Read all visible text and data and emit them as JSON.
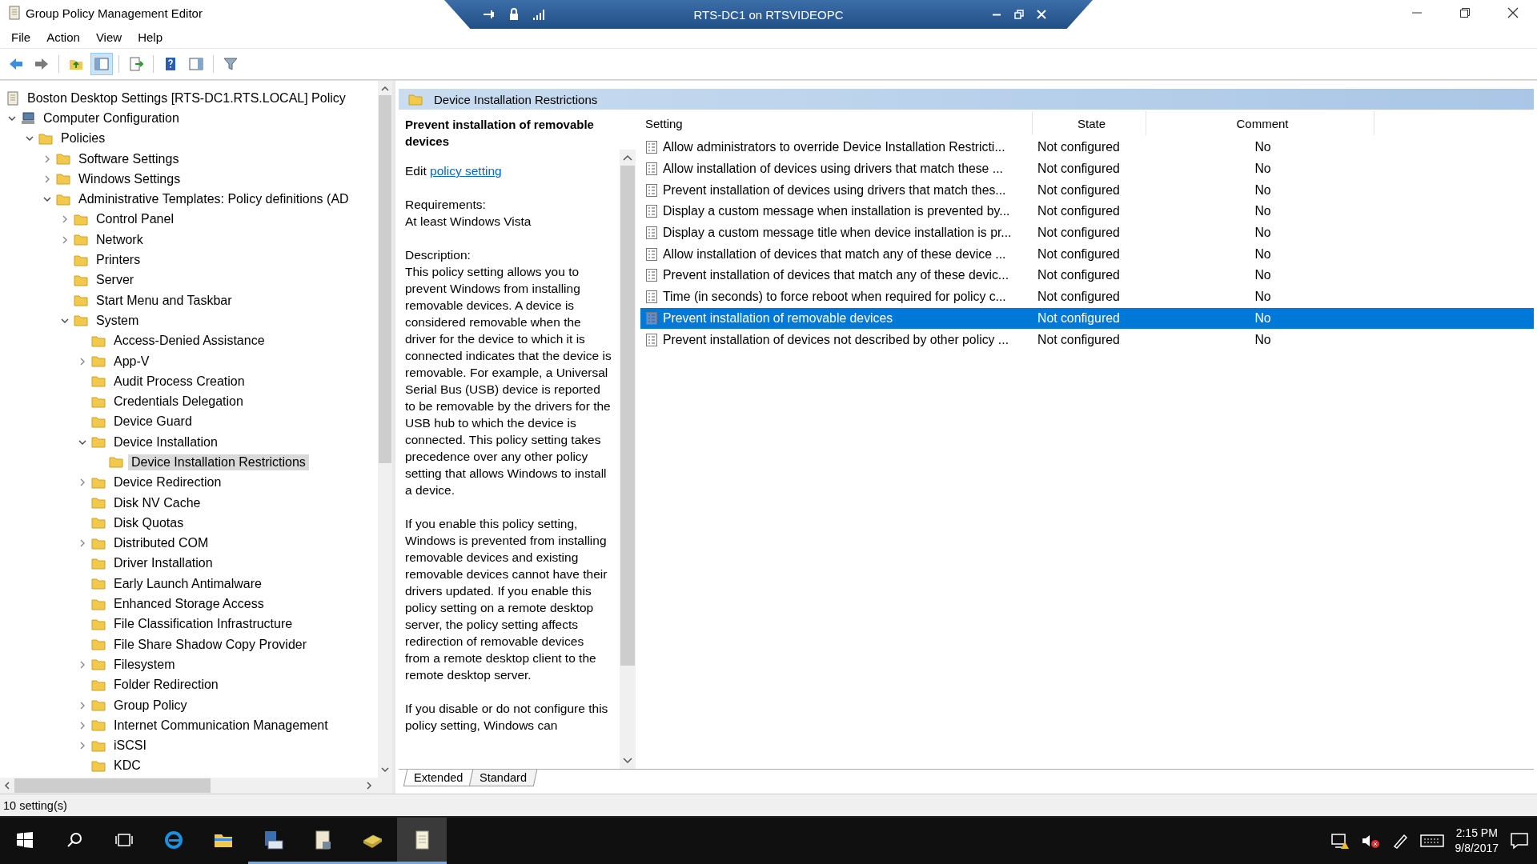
{
  "window": {
    "title": "Group Policy Management Editor"
  },
  "remote_bar": {
    "title": "RTS-DC1 on RTSVIDEOPC"
  },
  "menu": [
    "File",
    "Action",
    "View",
    "Help"
  ],
  "toolbar": [
    {
      "kind": "back"
    },
    {
      "kind": "forward"
    },
    {
      "kind": "sep"
    },
    {
      "kind": "up"
    },
    {
      "kind": "tree"
    },
    {
      "kind": "sep"
    },
    {
      "kind": "export"
    },
    {
      "kind": "sep"
    },
    {
      "kind": "help"
    },
    {
      "kind": "pane"
    },
    {
      "kind": "sep"
    },
    {
      "kind": "filter"
    }
  ],
  "tree": {
    "root": "Boston Desktop Settings [RTS-DC1.RTS.LOCAL] Policy",
    "items": [
      {
        "label": "Computer Configuration",
        "kind": "computer",
        "expanded": true,
        "children": [
          {
            "label": "Policies",
            "kind": "folder",
            "expanded": true,
            "children": [
              {
                "label": "Software Settings",
                "kind": "folder",
                "expanded": false
              },
              {
                "label": "Windows Settings",
                "kind": "folder",
                "expanded": false
              },
              {
                "label": "Administrative Templates: Policy definitions (AD",
                "kind": "folder",
                "expanded": true,
                "children": [
                  {
                    "label": "Control Panel",
                    "kind": "folder",
                    "expanded": false
                  },
                  {
                    "label": "Network",
                    "kind": "folder",
                    "expanded": false
                  },
                  {
                    "label": "Printers",
                    "kind": "folder"
                  },
                  {
                    "label": "Server",
                    "kind": "folder"
                  },
                  {
                    "label": "Start Menu and Taskbar",
                    "kind": "folder"
                  },
                  {
                    "label": "System",
                    "kind": "folder",
                    "expanded": true,
                    "children": [
                      {
                        "label": "Access-Denied Assistance",
                        "kind": "folder"
                      },
                      {
                        "label": "App-V",
                        "kind": "folder",
                        "expanded": false
                      },
                      {
                        "label": "Audit Process Creation",
                        "kind": "folder"
                      },
                      {
                        "label": "Credentials Delegation",
                        "kind": "folder"
                      },
                      {
                        "label": "Device Guard",
                        "kind": "folder"
                      },
                      {
                        "label": "Device Installation",
                        "kind": "folder",
                        "expanded": true,
                        "children": [
                          {
                            "label": "Device Installation Restrictions",
                            "kind": "folder",
                            "selected": true
                          }
                        ]
                      },
                      {
                        "label": "Device Redirection",
                        "kind": "folder",
                        "expanded": false
                      },
                      {
                        "label": "Disk NV Cache",
                        "kind": "folder"
                      },
                      {
                        "label": "Disk Quotas",
                        "kind": "folder"
                      },
                      {
                        "label": "Distributed COM",
                        "kind": "folder",
                        "expanded": false
                      },
                      {
                        "label": "Driver Installation",
                        "kind": "folder"
                      },
                      {
                        "label": "Early Launch Antimalware",
                        "kind": "folder"
                      },
                      {
                        "label": "Enhanced Storage Access",
                        "kind": "folder"
                      },
                      {
                        "label": "File Classification Infrastructure",
                        "kind": "folder"
                      },
                      {
                        "label": "File Share Shadow Copy Provider",
                        "kind": "folder"
                      },
                      {
                        "label": "Filesystem",
                        "kind": "folder",
                        "expanded": false
                      },
                      {
                        "label": "Folder Redirection",
                        "kind": "folder"
                      },
                      {
                        "label": "Group Policy",
                        "kind": "folder",
                        "expanded": false
                      },
                      {
                        "label": "Internet Communication Management",
                        "kind": "folder",
                        "expanded": false
                      },
                      {
                        "label": "iSCSI",
                        "kind": "folder",
                        "expanded": false
                      },
                      {
                        "label": "KDC",
                        "kind": "folder"
                      }
                    ]
                  }
                ]
              }
            ]
          }
        ]
      }
    ]
  },
  "pane_header": "Device Installation Restrictions",
  "description": {
    "title": "Prevent installation of removable devices",
    "edit_prefix": "Edit",
    "edit_link": "policy setting",
    "requirements_label": "Requirements:",
    "requirements": "At least Windows Vista",
    "description_label": "Description:",
    "paragraphs": [
      "This policy setting allows you to prevent Windows from installing removable devices. A device is considered removable when the driver for the device to which it is connected indicates that the device is removable. For example, a Universal Serial Bus (USB) device is reported to be removable by the drivers for the USB hub to which the device is connected. This policy setting takes precedence over any other policy setting that allows Windows to install a device.",
      "If you enable this policy setting, Windows is prevented from installing removable devices and existing removable devices cannot have their drivers updated. If you enable this policy setting on a remote desktop server, the policy setting affects redirection of removable devices from a remote desktop client to the remote desktop server.",
      "If you disable or do not configure this policy setting, Windows can"
    ]
  },
  "table": {
    "columns": [
      "Setting",
      "State",
      "Comment"
    ],
    "rows": [
      {
        "setting": "Allow administrators to override Device Installation Restricti...",
        "state": "Not configured",
        "comment": "No",
        "selected": false
      },
      {
        "setting": "Allow installation of devices using drivers that match these ...",
        "state": "Not configured",
        "comment": "No",
        "selected": false
      },
      {
        "setting": "Prevent installation of devices using drivers that match thes...",
        "state": "Not configured",
        "comment": "No",
        "selected": false
      },
      {
        "setting": "Display a custom message when installation is prevented by...",
        "state": "Not configured",
        "comment": "No",
        "selected": false
      },
      {
        "setting": "Display a custom message title when device installation is pr...",
        "state": "Not configured",
        "comment": "No",
        "selected": false
      },
      {
        "setting": "Allow installation of devices that match any of these device ...",
        "state": "Not configured",
        "comment": "No",
        "selected": false
      },
      {
        "setting": "Prevent installation of devices that match any of these devic...",
        "state": "Not configured",
        "comment": "No",
        "selected": false
      },
      {
        "setting": "Time (in seconds) to force reboot when required for policy c...",
        "state": "Not configured",
        "comment": "No",
        "selected": false
      },
      {
        "setting": "Prevent installation of removable devices",
        "state": "Not configured",
        "comment": "No",
        "selected": true
      },
      {
        "setting": "Prevent installation of devices not described by other policy ...",
        "state": "Not configured",
        "comment": "No",
        "selected": false
      }
    ]
  },
  "view_tabs": [
    {
      "label": "Extended",
      "selected": true
    },
    {
      "label": "Standard",
      "selected": false
    }
  ],
  "status_bar": {
    "text": "10 setting(s)"
  },
  "taskbar": {
    "apps": [
      {
        "kind": "ie",
        "running": false,
        "selected": false
      },
      {
        "kind": "explorer",
        "running": false,
        "selected": false
      },
      {
        "kind": "server",
        "running": true,
        "selected": false
      },
      {
        "kind": "script",
        "running": true,
        "selected": false
      },
      {
        "kind": "book",
        "running": true,
        "selected": false
      },
      {
        "kind": "notepad",
        "running": true,
        "selected": true
      }
    ],
    "time": "2:15 PM",
    "date": "9/8/2017"
  }
}
